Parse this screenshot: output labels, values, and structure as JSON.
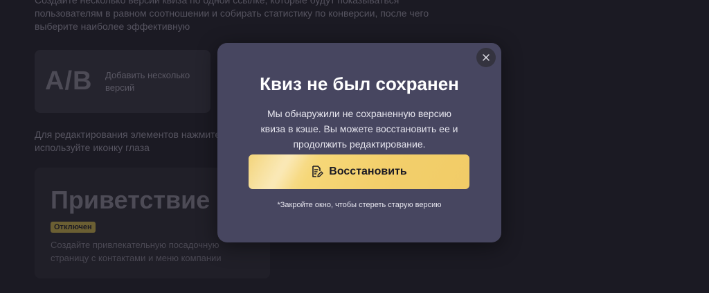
{
  "background": {
    "intro_lines": [
      "Создайте несколько версий квиза по одной ссылке, которые будут показываться",
      "пользователям в равном соотношении и собирать статистику по конверсии, после чего",
      "выберите наиболее эффективную"
    ],
    "ab_card": {
      "logo": "A/B",
      "label": "Добавить несколько версий"
    },
    "edit_hint_lines": [
      "Для редактирования элементов нажмите",
      "используйте иконку глаза"
    ],
    "welcome_card": {
      "title": "Приветствие",
      "badge": "Отключен",
      "description_lines": [
        "Создайте привлекательную посадочную",
        "страницу с контактами и меню компании"
      ]
    }
  },
  "modal": {
    "title": "Квиз не был сохранен",
    "message_lines": [
      "Мы обнаружили не сохраненную версию",
      "квиза в кэше. Вы можете восстановить ее и",
      "продолжить редактирование."
    ],
    "restore_button": {
      "label": "Восстановить",
      "icon": "edit-document-icon"
    },
    "close_icon": "close-icon",
    "hint": "*Закройте окно, чтобы стереть старую версию"
  },
  "colors": {
    "page_background": "#1b1a23",
    "modal_background": "#474660",
    "accent": "#f3cf6b",
    "badge": "#6b5f33"
  }
}
